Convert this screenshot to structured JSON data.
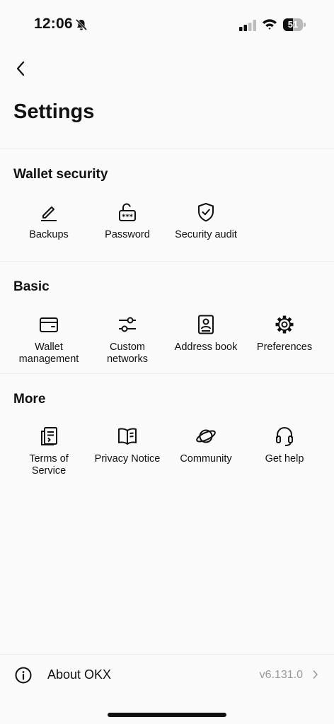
{
  "status_bar": {
    "time": "12:06",
    "battery_percent": "51",
    "battery_level": 0.51
  },
  "header": {
    "title": "Settings"
  },
  "sections": [
    {
      "title": "Wallet security",
      "items": [
        {
          "label": "Backups",
          "icon": "pen-icon"
        },
        {
          "label": "Password",
          "icon": "unlocked-padlock-icon"
        },
        {
          "label": "Security audit",
          "icon": "shield-check-icon"
        }
      ]
    },
    {
      "title": "Basic",
      "items": [
        {
          "label": "Wallet\nmanagement",
          "icon": "wallet-icon"
        },
        {
          "label": "Custom\nnetworks",
          "icon": "sliders-icon"
        },
        {
          "label": "Address book",
          "icon": "address-book-icon"
        },
        {
          "label": "Preferences",
          "icon": "gear-icon"
        }
      ]
    },
    {
      "title": "More",
      "items": [
        {
          "label": "Terms of\nService",
          "icon": "document-icon"
        },
        {
          "label": "Privacy Notice",
          "icon": "open-book-icon"
        },
        {
          "label": "Community",
          "icon": "planet-icon"
        },
        {
          "label": "Get help",
          "icon": "headset-icon"
        }
      ]
    }
  ],
  "about": {
    "label": "About OKX",
    "version": "v6.131.0"
  }
}
